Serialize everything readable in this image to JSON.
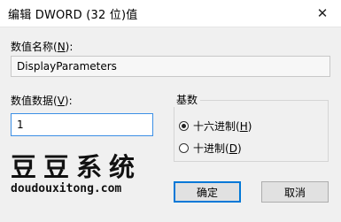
{
  "window": {
    "title": "编辑 DWORD (32 位)值",
    "close_glyph": "✕"
  },
  "value_name": {
    "label_prefix": "数值名称(",
    "label_key": "N",
    "label_suffix": "):",
    "value": "DisplayParameters"
  },
  "value_data": {
    "label_prefix": "数值数据(",
    "label_key": "V",
    "label_suffix": "):",
    "value": "1"
  },
  "base": {
    "title": "基数",
    "options": [
      {
        "label_prefix": "十六进制(",
        "key": "H",
        "label_suffix": ")",
        "checked": true
      },
      {
        "label_prefix": "十进制(",
        "key": "D",
        "label_suffix": ")",
        "checked": false
      }
    ]
  },
  "watermark": {
    "text": "豆豆系统",
    "url": "doudouxitong.com"
  },
  "buttons": {
    "ok": "确定",
    "cancel": "取消"
  }
}
